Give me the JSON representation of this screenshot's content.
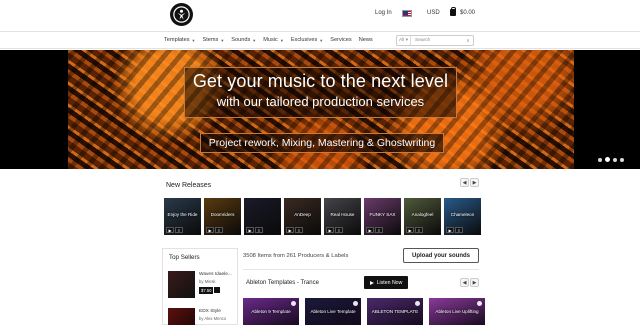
{
  "header": {
    "logo_icon": "person-logo-icon",
    "login_label": "Log In",
    "flag_icon": "us-flag-icon",
    "currency": "USD",
    "cart_icon": "shopping-bag-icon",
    "cart_total": "$0.00"
  },
  "nav": {
    "items": [
      {
        "label": "Templates",
        "dropdown": true
      },
      {
        "label": "Stems",
        "dropdown": true
      },
      {
        "label": "Sounds",
        "dropdown": true
      },
      {
        "label": "Music",
        "dropdown": true
      },
      {
        "label": "Exclusives",
        "dropdown": true
      },
      {
        "label": "Services",
        "dropdown": false
      },
      {
        "label": "News",
        "dropdown": false
      }
    ],
    "search": {
      "scope": "All",
      "placeholder": "Search",
      "icon": "search-icon"
    }
  },
  "banner": {
    "headline_line1": "Get your music to the next level",
    "headline_line2": "with our tailored production services",
    "subline": "Project rework, Mixing, Mastering & Ghostwriting",
    "slides_count": 4,
    "active_slide": 2,
    "colors": {
      "accent_border": "#c87a3a",
      "art_base": "#3a1602"
    }
  },
  "new_releases": {
    "title": "New Releases",
    "prev_icon": "chevron-left-icon",
    "next_icon": "chevron-right-icon",
    "items": [
      {
        "caption": "Enjoy the Ride",
        "bg": "#2a3a4a"
      },
      {
        "caption": "Doomriders",
        "bg": "#5a3a10"
      },
      {
        "caption": "",
        "bg": "#1a1a2a"
      },
      {
        "caption": "AnDeep",
        "bg": "#3a2a22"
      },
      {
        "caption": "Real House",
        "bg": "#45454a"
      },
      {
        "caption": "FUNKY SAX",
        "bg": "#6a3a6a"
      },
      {
        "caption": "Analogfeel",
        "bg": "#505a3a"
      },
      {
        "caption": "Chameleon",
        "bg": "#2a5a8a"
      }
    ]
  },
  "top_sellers": {
    "title": "Top Sellers",
    "items": [
      {
        "name": "Waves Idaele...",
        "by": "by Minsk",
        "price": "$7.50",
        "bg": "#3a1a1a"
      },
      {
        "name": "EDX Style",
        "by": "by Alex Menco",
        "price": "",
        "bg": "#5a1010"
      }
    ]
  },
  "listing": {
    "count_text": "3508 Items from 261 Producers & Labels",
    "upload_label": "Upload your sounds",
    "category_title": "Ableton Templates - Trance",
    "listen_label": "Listen Now",
    "products": [
      {
        "caption": "Ableton 9 Template",
        "bg": "#6a2a8a"
      },
      {
        "caption": "Ableton Live Template",
        "bg": "#1a1a3a"
      },
      {
        "caption": "ABLETON TEMPLATE",
        "bg": "#4a2a6a"
      },
      {
        "caption": "Ableton Live Uplifting",
        "bg": "#8a3a9a"
      }
    ]
  }
}
